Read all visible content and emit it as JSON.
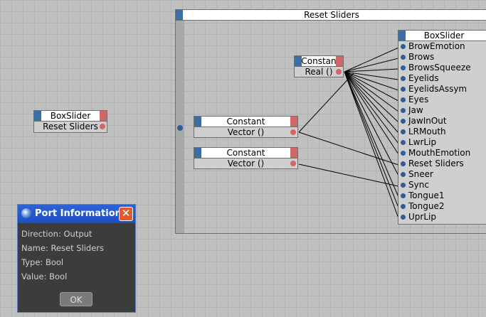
{
  "group": {
    "title": "Reset Sliders"
  },
  "standalone_node": {
    "title": "BoxSlider",
    "port": "Reset Sliders"
  },
  "constant_real": {
    "title": "Constan",
    "port": "Real ()"
  },
  "constant_vector_1": {
    "title": "Constant",
    "port": "Vector ()"
  },
  "constant_vector_2": {
    "title": "Constant",
    "port": "Vector ()"
  },
  "boxslider_node": {
    "title": "BoxSlider",
    "inputs": [
      "BrowEmotion",
      "Brows",
      "BrowsSqueeze",
      "Eyelids",
      "EyelidsAssym",
      "Eyes",
      "Jaw",
      "JawInOut",
      "LRMouth",
      "LwrLip",
      "MouthEmotion",
      "Reset Sliders",
      "Sneer",
      "Sync",
      "Tongue1",
      "Tongue2",
      "UprLip"
    ]
  },
  "dialog": {
    "title": "Port Information",
    "direction": "Direction: Output",
    "name": "Name: Reset Sliders",
    "type": "Type: Bool",
    "value": "Value: Bool",
    "ok_label": "OK"
  },
  "colors": {
    "input_tab": "#3a6ea5",
    "output_tab": "#d06666",
    "dialog_title": "#2e62d8"
  }
}
